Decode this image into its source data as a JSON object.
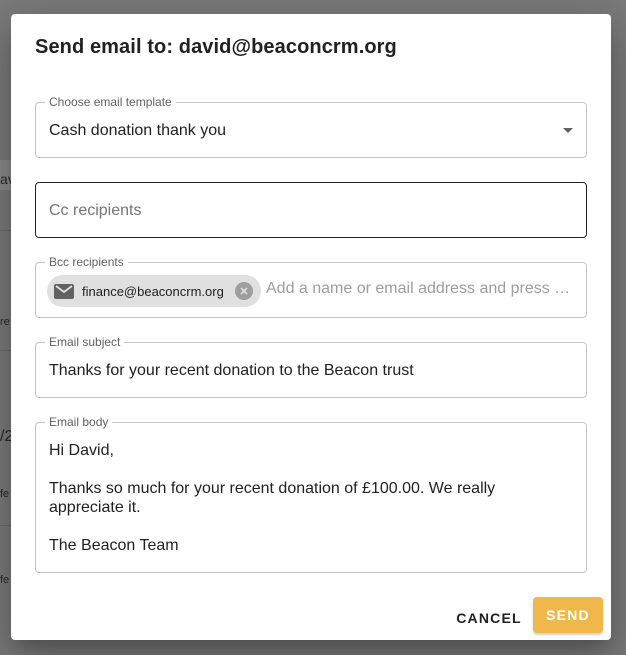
{
  "background": {
    "fragments": [
      "av",
      "re",
      "/2",
      "fe",
      "fe"
    ]
  },
  "dialog": {
    "title": "Send email to: david@beaconcrm.org",
    "template": {
      "label": "Choose email template",
      "value": "Cash donation thank you",
      "icon": "dropdown-arrow-icon"
    },
    "cc": {
      "placeholder": "Cc recipients"
    },
    "bcc": {
      "label": "Bcc recipients",
      "chip": {
        "icon": "email-icon",
        "label": "finance@beaconcrm.org",
        "remove_icon": "cancel-circle-icon"
      },
      "input_placeholder": "Add a name or email address and press e..."
    },
    "subject": {
      "label": "Email subject",
      "value": "Thanks for your recent donation to the Beacon trust"
    },
    "body": {
      "label": "Email body",
      "lines": [
        "Hi David,",
        "",
        "Thanks so much for your recent donation of £100.00.  We really",
        "appreciate it.",
        "",
        "The Beacon Team"
      ]
    },
    "actions": {
      "cancel_label": "CANCEL",
      "send_label": "SEND"
    },
    "colors": {
      "send_button": "#f0b84b",
      "overlay": "#7a7a7a"
    }
  }
}
